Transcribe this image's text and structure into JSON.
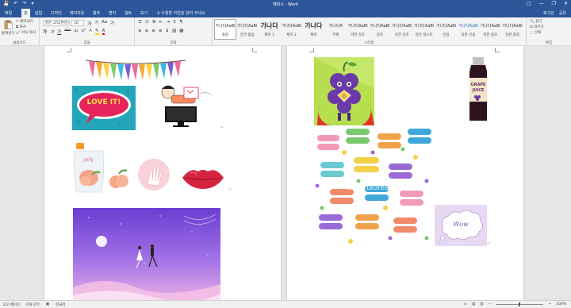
{
  "titlebar": {
    "title": "해피스 - Word",
    "qat": [
      "💾",
      "↶",
      "↷",
      "▾"
    ],
    "win": [
      "▢",
      "—",
      "❐",
      "✕"
    ]
  },
  "tabs": [
    "파일",
    "홈",
    "삽입",
    "디자인",
    "레이아웃",
    "참조",
    "편지",
    "검토",
    "보기"
  ],
  "tell_me": "♀ 수행할 작업을 알려 주세요",
  "account": [
    "로그인",
    "공유"
  ],
  "clipboard": {
    "paste": "붙여넣기",
    "cut": "잘라내기",
    "copy": "복사",
    "format_painter": "서식 복사",
    "label": "클립보드"
  },
  "font": {
    "name": "맑은 고딕(본문)",
    "size": "10",
    "grow": "가",
    "shrink": "가",
    "aa": "Aa",
    "clear": "가",
    "bold": "가",
    "italic": "가",
    "underline": "가",
    "strike": "abc",
    "subscript": "x₂",
    "superscript": "x²",
    "label": "글꼴"
  },
  "paragraph": {
    "label": "단락"
  },
  "styles": {
    "label": "스타일",
    "items": [
      {
        "preview": "가나다AaBl",
        "name": "표준",
        "big": false,
        "blue": false
      },
      {
        "preview": "가나다AaBl",
        "name": "간격 없음",
        "big": false,
        "blue": false
      },
      {
        "preview": "가나다",
        "name": "제목 1",
        "big": true,
        "blue": false
      },
      {
        "preview": "가나다AaBl",
        "name": "제목 2",
        "big": false,
        "blue": false
      },
      {
        "preview": "가나다",
        "name": "제목",
        "big": true,
        "blue": false
      },
      {
        "preview": "가나다A",
        "name": "부제",
        "big": false,
        "blue": false
      },
      {
        "preview": "가나다AaBl",
        "name": "약한 강조",
        "big": false,
        "blue": false
      },
      {
        "preview": "가나다AaBl",
        "name": "강조",
        "big": false,
        "blue": false
      },
      {
        "preview": "가나다AaBl",
        "name": "강한 강조",
        "big": false,
        "blue": false
      },
      {
        "preview": "가나다AaBl",
        "name": "굵은 텍스트",
        "big": false,
        "blue": false
      },
      {
        "preview": "가나다AaBl",
        "name": "인용",
        "big": false,
        "blue": false
      },
      {
        "preview": "가나다AaBl",
        "name": "강한 인용",
        "big": false,
        "blue": true
      },
      {
        "preview": "가나다AaBl",
        "name": "약한 참조",
        "big": false,
        "blue": false
      },
      {
        "preview": "가나다AaBl",
        "name": "강한 참조",
        "big": false,
        "blue": false
      }
    ]
  },
  "editing": {
    "find": "찾기",
    "replace": "바꾸기",
    "select": "선택",
    "label": "편집"
  },
  "page2": {
    "watermark": "Clipartkorea",
    "speech_text": "Wow"
  },
  "page1": {
    "love_text": "LOVE IT!",
    "jelly_text": "Jelly"
  },
  "status": {
    "page": "2/2 페이지",
    "words": "0개 단어",
    "lang": "한국어",
    "zoom": "100%",
    "zoom_minus": "−",
    "zoom_plus": "+"
  }
}
